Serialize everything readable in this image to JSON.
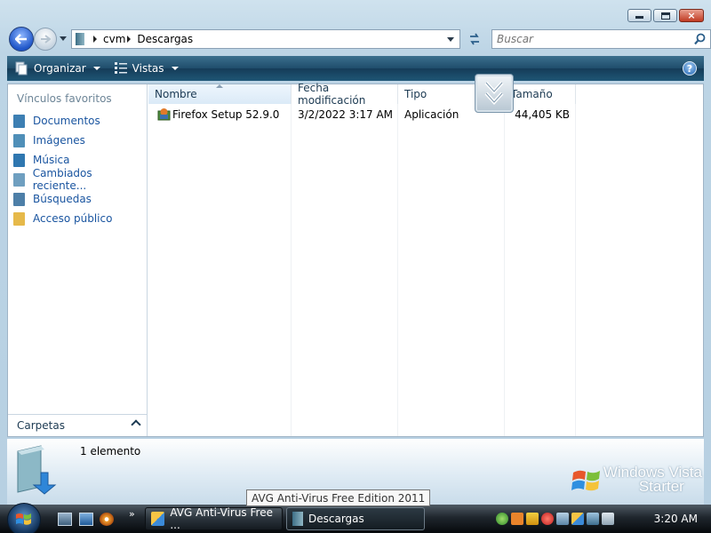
{
  "window": {
    "caption_buttons": [
      "minimize-icon",
      "maximize-icon",
      "close-icon"
    ],
    "close_glyph": "×"
  },
  "navigation": {
    "breadcrumb": [
      "cvm",
      "Descargas"
    ],
    "search_placeholder": "Buscar"
  },
  "command_bar": {
    "organize_label": "Organizar",
    "views_label": "Vistas",
    "help_glyph": "?"
  },
  "nav_pane": {
    "favorites_header": "Vínculos favoritos",
    "items": [
      {
        "label": "Documentos",
        "icon": "documents-icon",
        "color": "#3d7fb3"
      },
      {
        "label": "Imágenes",
        "icon": "pictures-icon",
        "color": "#4f8fb8"
      },
      {
        "label": "Música",
        "icon": "music-icon",
        "color": "#2f77b0"
      },
      {
        "label": "Cambiados reciente...",
        "icon": "recent-icon",
        "color": "#6f9fc0"
      },
      {
        "label": "Búsquedas",
        "icon": "searches-icon",
        "color": "#4d7fa8"
      },
      {
        "label": "Acceso público",
        "icon": "public-folder-icon",
        "color": "#e6b94a"
      }
    ],
    "folders_label": "Carpetas"
  },
  "file_list": {
    "columns": [
      "Nombre",
      "Fecha modificación",
      "Tipo",
      "Tamaño"
    ],
    "sorted_column": "Nombre",
    "rows": [
      {
        "name": "Firefox Setup 52.9.0",
        "modified": "3/2/2022 3:17 AM",
        "type": "Aplicación",
        "size": "44,405 KB",
        "icon": "installer-icon"
      }
    ]
  },
  "details_pane": {
    "item_count": "1 elemento",
    "brand_line1": "Windows Vista",
    "brand_line2": "Starter"
  },
  "tooltip": {
    "text": "AVG Anti-Virus Free Edition 2011"
  },
  "taskbar": {
    "more_glyph": "»",
    "buttons": [
      {
        "label": "AVG Anti-Virus Free ...",
        "icon": "avg-icon",
        "active": false
      },
      {
        "label": "Descargas",
        "icon": "explorer-folder-icon",
        "active": true
      }
    ],
    "tray_icons": [
      "utorrent-icon",
      "tray-app-icon",
      "warning-icon",
      "security-alert-icon",
      "network-icon",
      "avg-tray-icon",
      "network-disconnected-icon",
      "volume-muted-icon"
    ],
    "clock": "3:20 AM"
  }
}
